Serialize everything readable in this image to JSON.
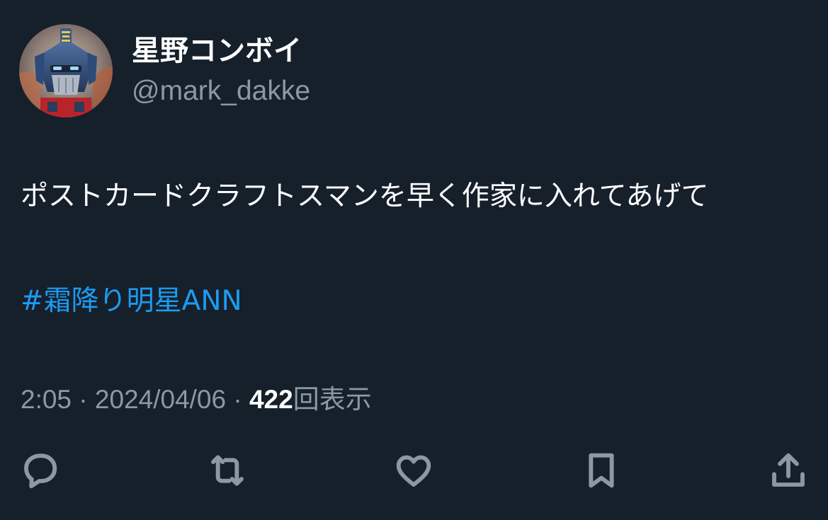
{
  "tweet": {
    "author": {
      "display_name": "星野コンボイ",
      "handle": "@mark_dakke",
      "avatar_icon": "robot-avatar-icon"
    },
    "text": "ポストカードクラフトスマンを早く作家に入れてあげて",
    "hashtag": "#霜降り明星ANN",
    "meta": {
      "time": "2:05",
      "separator": "·",
      "date": "2024/04/06",
      "views_count": "422",
      "views_label": "回表示"
    },
    "actions": {
      "reply_icon": "reply-icon",
      "retweet_icon": "retweet-icon",
      "like_icon": "heart-icon",
      "bookmark_icon": "bookmark-icon",
      "share_icon": "share-icon"
    }
  },
  "colors": {
    "background": "#16202b",
    "text_primary": "#ffffff",
    "text_secondary": "#8b98a5",
    "link": "#1d9bf0"
  }
}
